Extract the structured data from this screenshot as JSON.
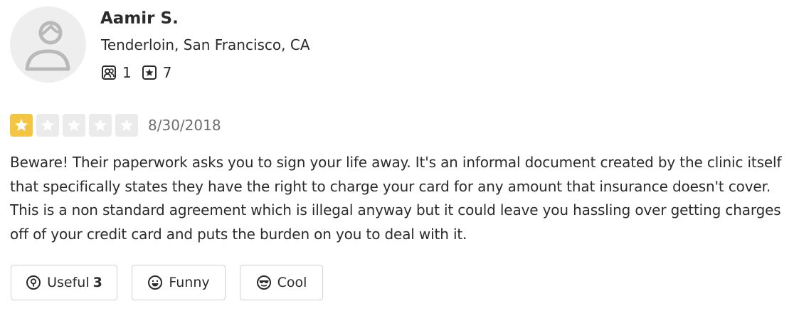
{
  "user": {
    "name": "Aamir S.",
    "location": "Tenderloin, San Francisco, CA",
    "friends_count": "1",
    "reviews_count": "7",
    "avatar_icon": "default-user-avatar-icon",
    "friends_icon": "friends-icon",
    "reviews_icon": "star-review-icon"
  },
  "review": {
    "rating": 1,
    "max_rating": 5,
    "date": "8/30/2018",
    "text": "Beware! Their paperwork asks you to sign your life away. It's an informal document created by the clinic itself that specifically states they have the right to charge your card for any amount that insurance doesn't cover. This is a non standard agreement which is illegal anyway but it could leave you hassling over getting charges off of your credit card and puts the burden on you to deal with it."
  },
  "actions": {
    "useful_label": "Useful",
    "useful_count": "3",
    "funny_label": "Funny",
    "cool_label": "Cool"
  },
  "colors": {
    "star_filled": "#f3c543",
    "star_empty": "#ebebeb",
    "text": "#2b2b2b",
    "muted": "#6e6e6e",
    "border": "#d2d2d2",
    "avatar_bg": "#eeeeee"
  }
}
